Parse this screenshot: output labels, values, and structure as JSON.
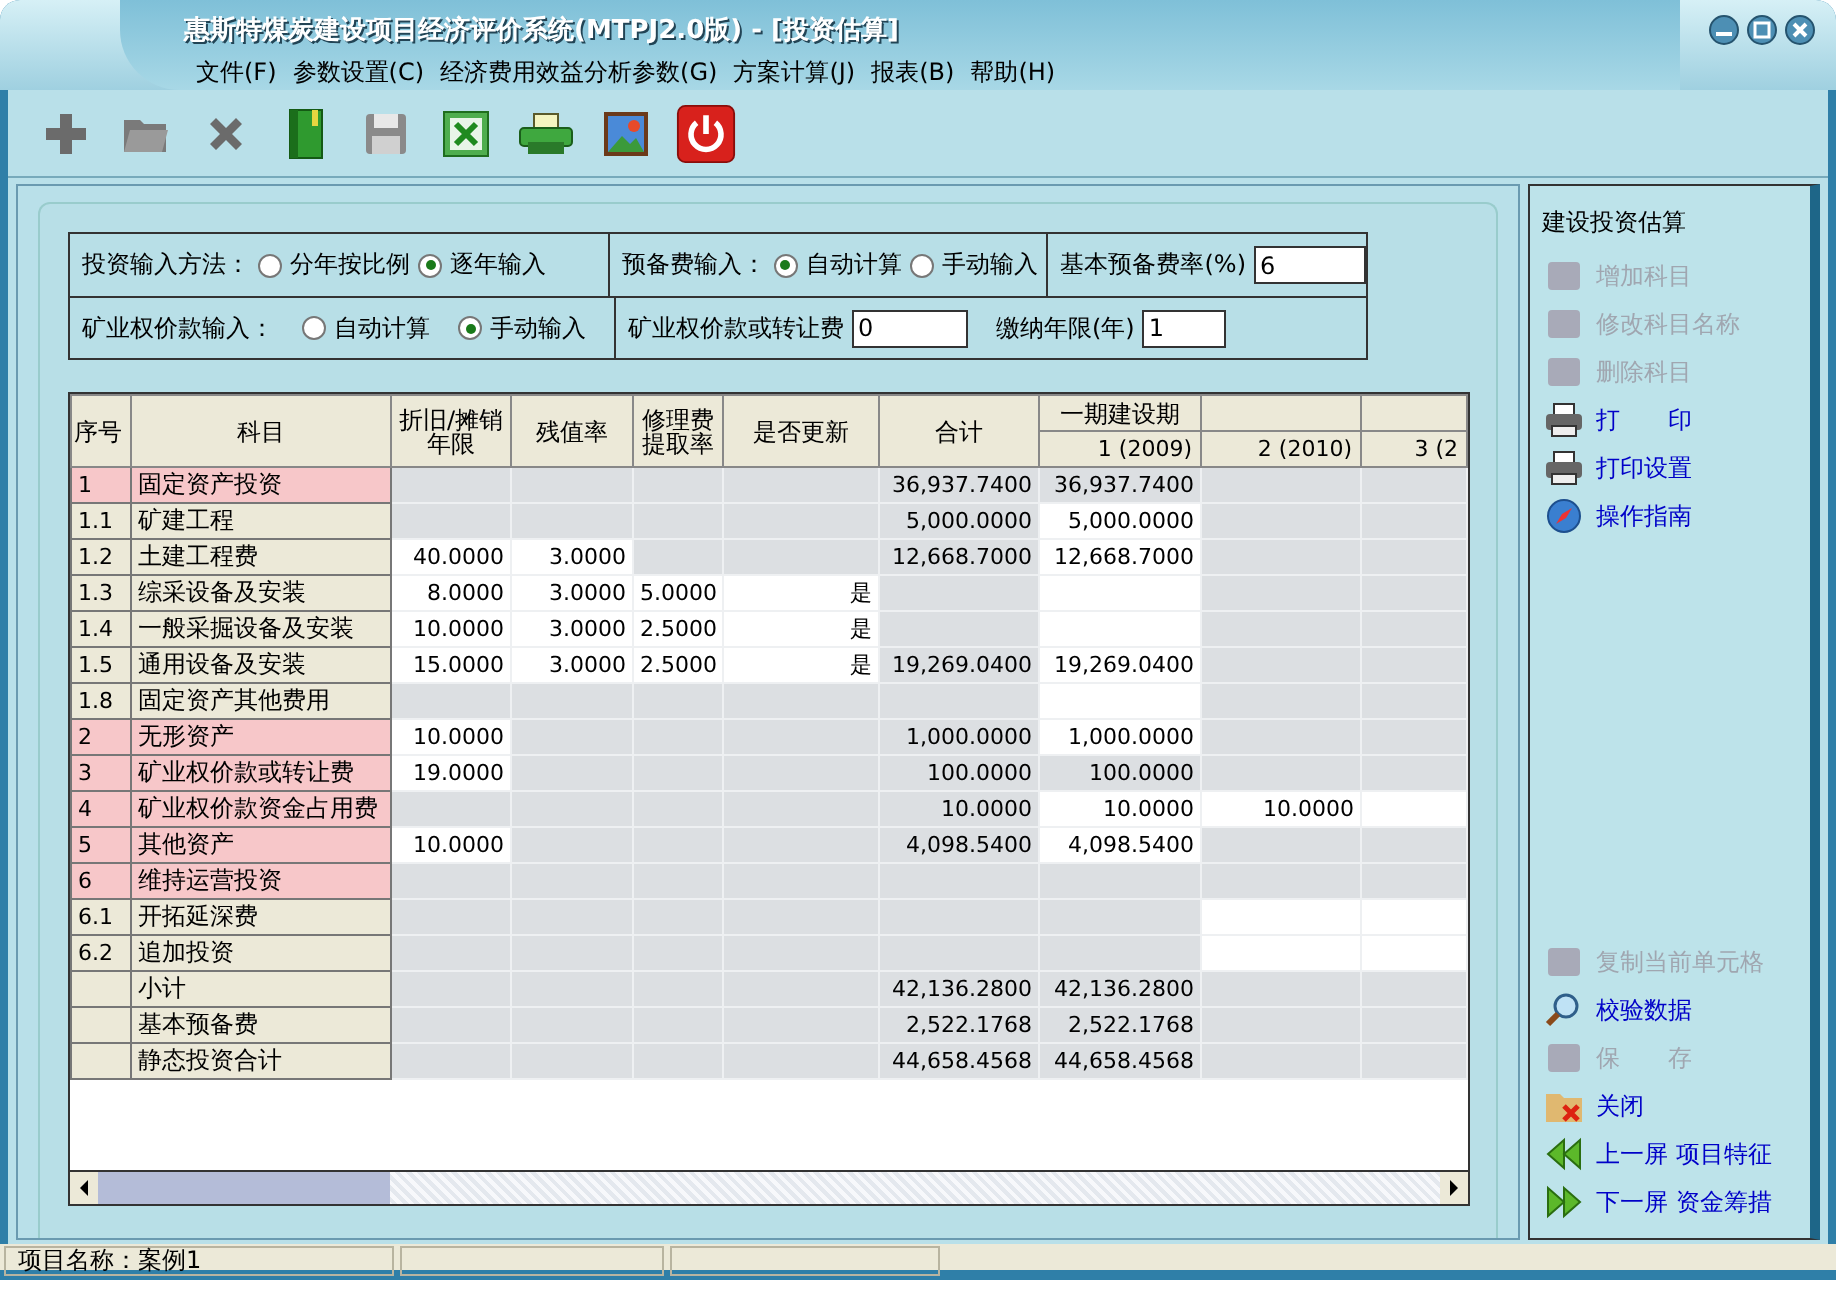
{
  "window": {
    "title": "惠斯特煤炭建设项目经济评价系统(MTPJ2.0版) - [投资估算]"
  },
  "menu": [
    "文件(F)",
    "参数设置(C)",
    "经济费用效益分析参数(G)",
    "方案计算(J)",
    "报表(B)",
    "帮助(H)"
  ],
  "form": {
    "method": {
      "label": "投资输入方法：",
      "options": [
        {
          "label": "分年按比例",
          "selected": false
        },
        {
          "label": "逐年输入",
          "selected": true
        }
      ]
    },
    "reserve": {
      "label": "预备费输入：",
      "options": [
        {
          "label": "自动计算",
          "selected": true
        },
        {
          "label": "手动输入",
          "selected": false
        }
      ]
    },
    "rate": {
      "label": "基本预备费率(%)",
      "value": "6"
    },
    "mining": {
      "label": "矿业权价款输入：",
      "options": [
        {
          "label": "自动计算",
          "selected": false
        },
        {
          "label": "手动输入",
          "selected": true
        }
      ]
    },
    "fee": {
      "label": "矿业权价款或转让费",
      "value": "0"
    },
    "years": {
      "label": "缴纳年限(年)",
      "value": "1"
    }
  },
  "table": {
    "columns": [
      "序号",
      "科目",
      "折旧/摊销年限",
      "残值率",
      "修理费提取率",
      "是否更新",
      "合计"
    ],
    "year_columns": [
      {
        "group": "一期建设期",
        "label": "1 (2009)"
      },
      {
        "label": "2 (2010)"
      },
      {
        "label": "3 (2"
      }
    ],
    "rows": [
      {
        "highlighted": true,
        "cells": [
          {
            "value": "1",
            "editable": false
          },
          {
            "value": "固定资产投资",
            "editable": false
          },
          {
            "editable": false
          },
          {
            "editable": false
          },
          {
            "editable": false
          },
          {
            "editable": false
          },
          {
            "value": "36,937.7400",
            "editable": false
          },
          {
            "value": "36,937.7400",
            "editable": false
          },
          {
            "editable": false
          },
          {
            "editable": false
          }
        ]
      },
      {
        "highlighted": false,
        "cells": [
          {
            "value": "1.1",
            "editable": false
          },
          {
            "value": "矿建工程",
            "editable": false
          },
          {
            "editable": false
          },
          {
            "editable": false
          },
          {
            "editable": false
          },
          {
            "editable": false
          },
          {
            "value": "5,000.0000",
            "editable": false
          },
          {
            "value": "5,000.0000",
            "editable": true
          },
          {
            "editable": false
          },
          {
            "editable": false
          }
        ]
      },
      {
        "highlighted": false,
        "cells": [
          {
            "value": "1.2",
            "editable": false
          },
          {
            "value": "土建工程费",
            "editable": false
          },
          {
            "value": "40.0000",
            "editable": true
          },
          {
            "value": "3.0000",
            "editable": true
          },
          {
            "editable": false
          },
          {
            "editable": false
          },
          {
            "value": "12,668.7000",
            "editable": false
          },
          {
            "value": "12,668.7000",
            "editable": true
          },
          {
            "editable": false
          },
          {
            "editable": false
          }
        ]
      },
      {
        "highlighted": false,
        "cells": [
          {
            "value": "1.3",
            "editable": false
          },
          {
            "value": "综采设备及安装",
            "editable": false
          },
          {
            "value": "8.0000",
            "editable": true
          },
          {
            "value": "3.0000",
            "editable": true
          },
          {
            "value": "5.0000",
            "editable": true
          },
          {
            "value": "是",
            "editable": true
          },
          {
            "editable": false
          },
          {
            "editable": true
          },
          {
            "editable": false
          },
          {
            "editable": false
          }
        ]
      },
      {
        "highlighted": false,
        "cells": [
          {
            "value": "1.4",
            "editable": false
          },
          {
            "value": "一般采掘设备及安装",
            "editable": false
          },
          {
            "value": "10.0000",
            "editable": true
          },
          {
            "value": "3.0000",
            "editable": true
          },
          {
            "value": "2.5000",
            "editable": true
          },
          {
            "value": "是",
            "editable": true
          },
          {
            "editable": false
          },
          {
            "editable": true
          },
          {
            "editable": false
          },
          {
            "editable": false
          }
        ]
      },
      {
        "highlighted": false,
        "cells": [
          {
            "value": "1.5",
            "editable": false
          },
          {
            "value": "通用设备及安装",
            "editable": false
          },
          {
            "value": "15.0000",
            "editable": true
          },
          {
            "value": "3.0000",
            "editable": true
          },
          {
            "value": "2.5000",
            "editable": true
          },
          {
            "value": "是",
            "editable": true
          },
          {
            "value": "19,269.0400",
            "editable": false
          },
          {
            "value": "19,269.0400",
            "editable": true
          },
          {
            "editable": false
          },
          {
            "editable": false
          }
        ]
      },
      {
        "highlighted": false,
        "cells": [
          {
            "value": "1.8",
            "editable": false
          },
          {
            "value": "固定资产其他费用",
            "editable": false
          },
          {
            "editable": false
          },
          {
            "editable": false
          },
          {
            "editable": false
          },
          {
            "editable": false
          },
          {
            "editable": false
          },
          {
            "editable": true
          },
          {
            "editable": false
          },
          {
            "editable": false
          }
        ]
      },
      {
        "highlighted": true,
        "cells": [
          {
            "value": "2",
            "editable": false
          },
          {
            "value": "无形资产",
            "editable": false
          },
          {
            "value": "10.0000",
            "editable": true
          },
          {
            "editable": false
          },
          {
            "editable": false
          },
          {
            "editable": false
          },
          {
            "value": "1,000.0000",
            "editable": false
          },
          {
            "value": "1,000.0000",
            "editable": true
          },
          {
            "editable": false
          },
          {
            "editable": false
          }
        ]
      },
      {
        "highlighted": true,
        "cells": [
          {
            "value": "3",
            "editable": false
          },
          {
            "value": "矿业权价款或转让费",
            "editable": false
          },
          {
            "value": "19.0000",
            "editable": true
          },
          {
            "editable": false
          },
          {
            "editable": false
          },
          {
            "editable": false
          },
          {
            "value": "100.0000",
            "editable": false
          },
          {
            "value": "100.0000",
            "editable": false
          },
          {
            "editable": false
          },
          {
            "editable": false
          }
        ]
      },
      {
        "highlighted": true,
        "cells": [
          {
            "value": "4",
            "editable": false
          },
          {
            "value": "矿业权价款资金占用费",
            "editable": false
          },
          {
            "editable": false
          },
          {
            "editable": false
          },
          {
            "editable": false
          },
          {
            "editable": false
          },
          {
            "value": "10.0000",
            "editable": false
          },
          {
            "value": "10.0000",
            "editable": true
          },
          {
            "value": "10.0000",
            "editable": true
          },
          {
            "editable": true
          }
        ]
      },
      {
        "highlighted": true,
        "cells": [
          {
            "value": "5",
            "editable": false
          },
          {
            "value": "其他资产",
            "editable": false
          },
          {
            "value": "10.0000",
            "editable": true
          },
          {
            "editable": false
          },
          {
            "editable": false
          },
          {
            "editable": false
          },
          {
            "value": "4,098.5400",
            "editable": false
          },
          {
            "value": "4,098.5400",
            "editable": true
          },
          {
            "editable": false
          },
          {
            "editable": false
          }
        ]
      },
      {
        "highlighted": true,
        "cells": [
          {
            "value": "6",
            "editable": false
          },
          {
            "value": "维持运营投资",
            "editable": false
          },
          {
            "editable": false
          },
          {
            "editable": false
          },
          {
            "editable": false
          },
          {
            "editable": false
          },
          {
            "editable": false
          },
          {
            "editable": false
          },
          {
            "editable": false
          },
          {
            "editable": false
          }
        ]
      },
      {
        "highlighted": false,
        "cells": [
          {
            "value": "6.1",
            "editable": false
          },
          {
            "value": "开拓延深费",
            "editable": false
          },
          {
            "editable": false
          },
          {
            "editable": false
          },
          {
            "editable": false
          },
          {
            "editable": false
          },
          {
            "editable": false
          },
          {
            "editable": false
          },
          {
            "editable": true
          },
          {
            "editable": true
          }
        ]
      },
      {
        "highlighted": false,
        "cells": [
          {
            "value": "6.2",
            "editable": false
          },
          {
            "value": "追加投资",
            "editable": false
          },
          {
            "editable": false
          },
          {
            "editable": false
          },
          {
            "editable": false
          },
          {
            "editable": false
          },
          {
            "editable": false
          },
          {
            "editable": false
          },
          {
            "editable": true
          },
          {
            "editable": true
          }
        ]
      },
      {
        "highlighted": false,
        "cells": [
          {
            "editable": false
          },
          {
            "value": "小计",
            "editable": false
          },
          {
            "editable": false
          },
          {
            "editable": false
          },
          {
            "editable": false
          },
          {
            "editable": false
          },
          {
            "value": "42,136.2800",
            "editable": false
          },
          {
            "value": "42,136.2800",
            "editable": false
          },
          {
            "editable": false
          },
          {
            "editable": false
          }
        ]
      },
      {
        "highlighted": false,
        "cells": [
          {
            "editable": false
          },
          {
            "value": "基本预备费",
            "editable": false
          },
          {
            "editable": false
          },
          {
            "editable": false
          },
          {
            "editable": false
          },
          {
            "editable": false
          },
          {
            "value": "2,522.1768",
            "editable": false
          },
          {
            "value": "2,522.1768",
            "editable": false
          },
          {
            "editable": false
          },
          {
            "editable": false
          }
        ]
      },
      {
        "highlighted": false,
        "cells": [
          {
            "editable": false
          },
          {
            "value": "静态投资合计",
            "editable": false
          },
          {
            "editable": false
          },
          {
            "editable": false
          },
          {
            "editable": false
          },
          {
            "editable": false
          },
          {
            "value": "44,658.4568",
            "editable": false
          },
          {
            "value": "44,658.4568",
            "editable": false
          },
          {
            "editable": false
          },
          {
            "editable": false
          }
        ]
      }
    ]
  },
  "sidebar": {
    "title": "建设投资估算",
    "top_items": [
      {
        "label": "增加科目",
        "disabled": true
      },
      {
        "label": "修改科目名称",
        "disabled": true
      },
      {
        "label": "删除科目",
        "disabled": true
      },
      {
        "label": "打　　印",
        "disabled": false
      },
      {
        "label": "打印设置",
        "disabled": false
      },
      {
        "label": "操作指南",
        "disabled": false
      }
    ],
    "bottom_items": [
      {
        "label": "复制当前单元格",
        "disabled": true
      },
      {
        "label": "校验数据",
        "disabled": false
      },
      {
        "label": "保　　存",
        "disabled": true
      },
      {
        "label": "关闭",
        "disabled": false
      },
      {
        "label": "上一屏 项目特征",
        "disabled": false
      },
      {
        "label": "下一屏 资金筹措",
        "disabled": false
      }
    ]
  },
  "status_bar": {
    "project": "项目名称：案例1"
  }
}
